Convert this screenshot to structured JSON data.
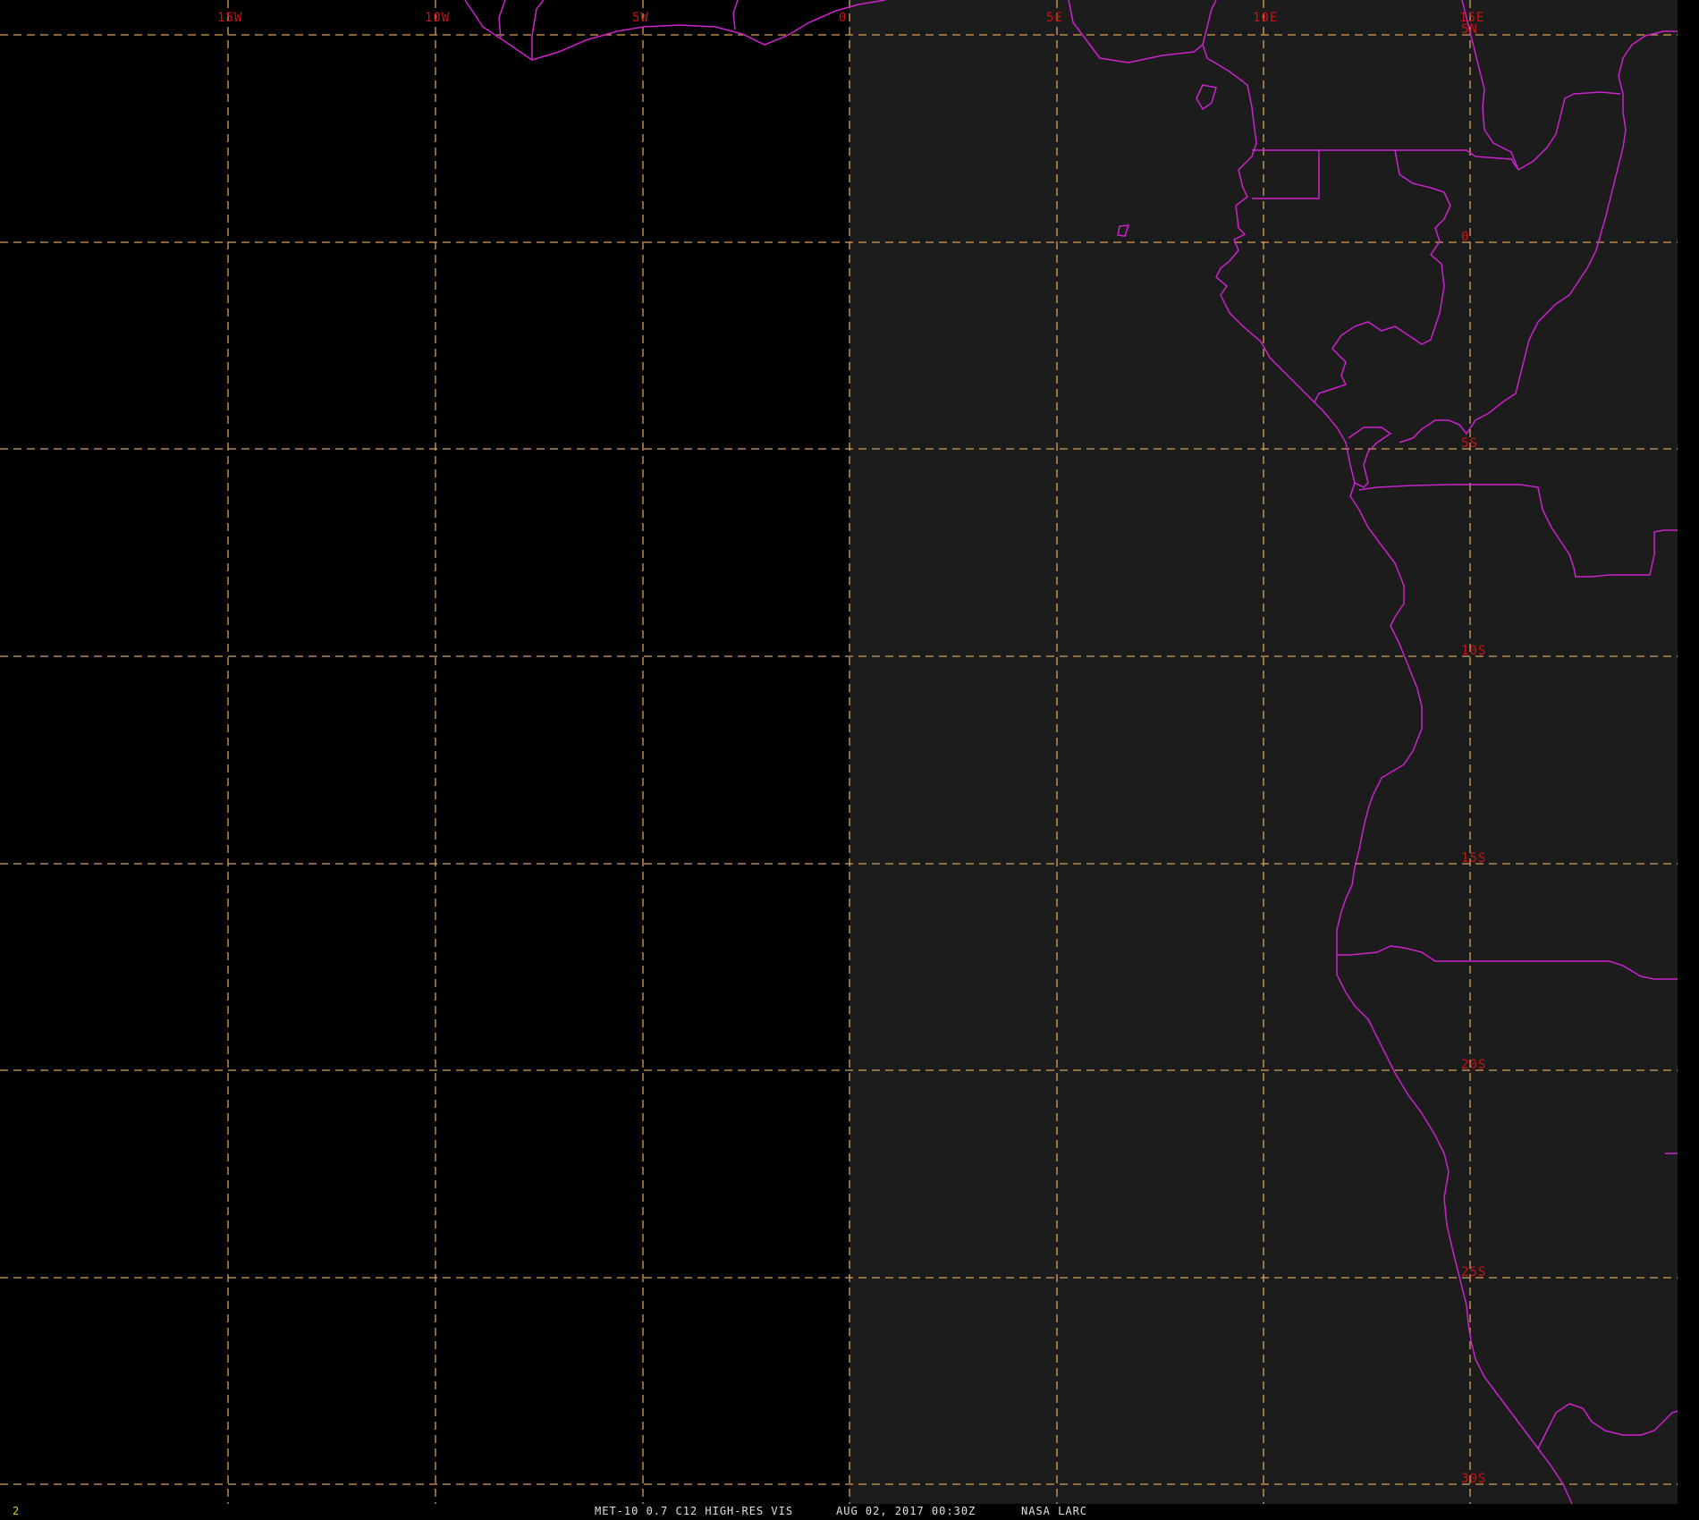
{
  "colors": {
    "background": "#000000",
    "imagery": "#1c1c1c",
    "grid": "#d9a05b",
    "coastline": "#cc22cc",
    "grid_label": "#cc1111",
    "frame_number": "#d8d800",
    "status_text": "#e0e0e0"
  },
  "grid": {
    "longitude_labels": [
      "15W",
      "10W",
      "5W",
      "0",
      "5E",
      "10E",
      "15E"
    ],
    "latitude_labels": [
      "5N",
      "0",
      "5S",
      "10S",
      "15S",
      "20S",
      "25S",
      "30S"
    ]
  },
  "status_bar": {
    "frame_number": "2",
    "product": "MET-10 0.7 C12 HIGH-RES VIS",
    "timestamp": "AUG 02, 2017 00:30Z",
    "source": "NASA LARC"
  }
}
